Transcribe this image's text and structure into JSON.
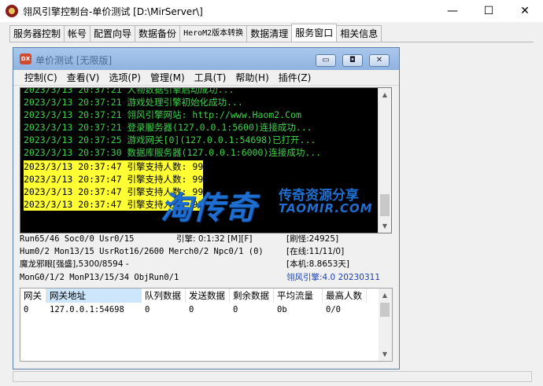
{
  "window": {
    "title": "翎风引擎控制台-单价测试 [D:\\MirServer\\]",
    "minimize": "—",
    "maximize": "☐",
    "close": "✕"
  },
  "tabs": [
    {
      "label": "服务器控制"
    },
    {
      "label": "帐号"
    },
    {
      "label": "配置向导"
    },
    {
      "label": "数据备份"
    },
    {
      "label": "HeroM2版本转换"
    },
    {
      "label": "数据清理"
    },
    {
      "label": "服务窗口"
    },
    {
      "label": "相关信息"
    }
  ],
  "child": {
    "icon_text": "DX",
    "title": "单价测试 [无限版]",
    "buttons": {
      "min": "▭",
      "max": "◘",
      "close": "✕"
    },
    "menu": [
      {
        "label": "控制(C)"
      },
      {
        "label": "查看(V)"
      },
      {
        "label": "选项(P)"
      },
      {
        "label": "管理(M)"
      },
      {
        "label": "工具(T)"
      },
      {
        "label": "帮助(H)"
      },
      {
        "label": "插件(Z)"
      }
    ],
    "console": [
      {
        "text": "2023/3/13 20:37:21 人物数据引擎启动成功...",
        "style": "green"
      },
      {
        "text": "2023/3/13 20:37:21 游戏处理引擎初始化成功...",
        "style": "green"
      },
      {
        "text": "2023/3/13 20:37:21 翎风引擎网站: http://www.Haom2.Com",
        "style": "green"
      },
      {
        "text": "2023/3/13 20:37:21 登录服务器(127.0.0.1:5600)连接成功...",
        "style": "green"
      },
      {
        "text": "2023/3/13 20:37:25 游戏网关[0](127.0.0.1:54698)已打开...",
        "style": "green"
      },
      {
        "text": "2023/3/13 20:37:30 数据库服务器(127.0.0.1:6000)连接成功...",
        "style": "green"
      },
      {
        "text": "2023/3/13 20:37:47 引擎支持人数: 99",
        "style": "yellow"
      },
      {
        "text": "2023/3/13 20:37:47 引擎支持人数: 99",
        "style": "yellow"
      },
      {
        "text": "2023/3/13 20:37:47 引擎支持人数: 99",
        "style": "yellow"
      },
      {
        "text": "2023/3/13 20:37:47 引擎支持人数: 99",
        "style": "yellow"
      }
    ],
    "status": {
      "run": "Run65/46 Soc0/0 Usr0/15",
      "engine_time": "引擎: 0:1:32 [M][F]",
      "refresh": "[刷怪:24925]",
      "hum": "Hum0/2 Mon13/15 UsrRot16/2600 Merch0/2 Npc0/1 (0)",
      "online": "[在线:11/11/0]",
      "monster": "魔龙邪眼[强盛],5300/8594 -",
      "local": "[本机:8.8653天]",
      "mongo": "MonG0/1/2 MonP13/15/34 ObjRun0/1",
      "version": "翎风引擎:4.0 20230311"
    },
    "gateway": {
      "columns": [
        "网关",
        "网关地址",
        "队列数据",
        "发送数据",
        "剩余数据",
        "平均流量",
        "最高人数"
      ],
      "rows": [
        [
          "0",
          "127.0.0.1:54698",
          "0",
          "0",
          "0",
          "0b",
          "0/0"
        ]
      ]
    }
  },
  "watermark": {
    "big": "淘传奇",
    "small": "传奇资源分享",
    "url": "TAOMIR.COM"
  },
  "colors": {
    "console_bg": "#000000",
    "console_green": "#3fd34a",
    "console_highlight": "#ffff33",
    "status_blue": "#1a3fb0",
    "watermark": "#1e6fd1"
  }
}
